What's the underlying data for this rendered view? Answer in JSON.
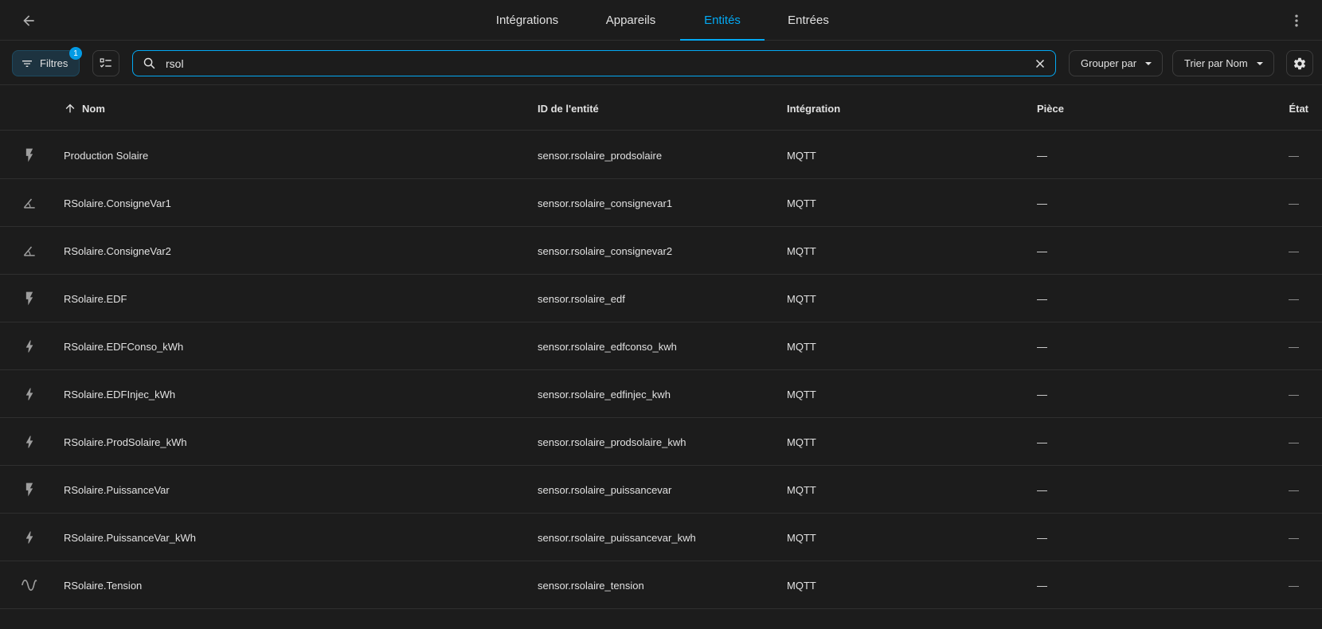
{
  "topbar": {
    "tabs": [
      {
        "label": "Intégrations",
        "active": false
      },
      {
        "label": "Appareils",
        "active": false
      },
      {
        "label": "Entités",
        "active": true
      },
      {
        "label": "Entrées",
        "active": false
      }
    ]
  },
  "toolbar": {
    "filters_label": "Filtres",
    "filters_badge": "1",
    "search_value": "rsol",
    "group_by_label": "Grouper par",
    "sort_label": "Trier par Nom"
  },
  "table": {
    "columns": {
      "name": "Nom",
      "entity_id": "ID de l'entité",
      "integration": "Intégration",
      "room": "Pièce",
      "state": "État"
    },
    "rows": [
      {
        "icon": "flash-icon",
        "name": "Production Solaire",
        "entity_id": "sensor.rsolaire_prodsolaire",
        "integration": "MQTT",
        "room": "—",
        "state": "—"
      },
      {
        "icon": "angle-icon",
        "name": "RSolaire.ConsigneVar1",
        "entity_id": "sensor.rsolaire_consignevar1",
        "integration": "MQTT",
        "room": "—",
        "state": "—"
      },
      {
        "icon": "angle-icon",
        "name": "RSolaire.ConsigneVar2",
        "entity_id": "sensor.rsolaire_consignevar2",
        "integration": "MQTT",
        "room": "—",
        "state": "—"
      },
      {
        "icon": "flash-icon",
        "name": "RSolaire.EDF",
        "entity_id": "sensor.rsolaire_edf",
        "integration": "MQTT",
        "room": "—",
        "state": "—"
      },
      {
        "icon": "lightning-icon",
        "name": "RSolaire.EDFConso_kWh",
        "entity_id": "sensor.rsolaire_edfconso_kwh",
        "integration": "MQTT",
        "room": "—",
        "state": "—"
      },
      {
        "icon": "lightning-icon",
        "name": "RSolaire.EDFInjec_kWh",
        "entity_id": "sensor.rsolaire_edfinjec_kwh",
        "integration": "MQTT",
        "room": "—",
        "state": "—"
      },
      {
        "icon": "lightning-icon",
        "name": "RSolaire.ProdSolaire_kWh",
        "entity_id": "sensor.rsolaire_prodsolaire_kwh",
        "integration": "MQTT",
        "room": "—",
        "state": "—"
      },
      {
        "icon": "flash-icon",
        "name": "RSolaire.PuissanceVar",
        "entity_id": "sensor.rsolaire_puissancevar",
        "integration": "MQTT",
        "room": "—",
        "state": "—"
      },
      {
        "icon": "lightning-icon",
        "name": "RSolaire.PuissanceVar_kWh",
        "entity_id": "sensor.rsolaire_puissancevar_kwh",
        "integration": "MQTT",
        "room": "—",
        "state": "—"
      },
      {
        "icon": "sine-wave-icon",
        "name": "RSolaire.Tension",
        "entity_id": "sensor.rsolaire_tension",
        "integration": "MQTT",
        "room": "—",
        "state": "—"
      }
    ]
  },
  "colors": {
    "accent": "#03a9f4",
    "background": "#1c1c1c",
    "icon": "#9e9e9e"
  }
}
